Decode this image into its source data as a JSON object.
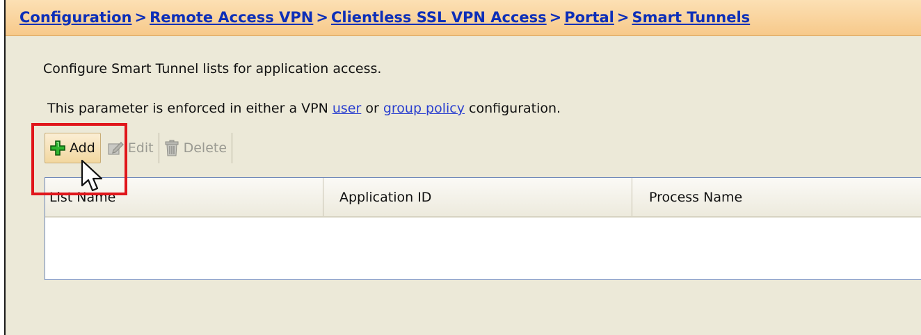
{
  "breadcrumb": {
    "items": [
      "Configuration",
      "Remote Access VPN",
      "Clientless SSL VPN Access",
      "Portal",
      "Smart Tunnels"
    ],
    "separator": ">"
  },
  "description": "Configure Smart Tunnel lists for application access.",
  "policy_note": {
    "prefix": "This parameter is enforced in either a VPN ",
    "link_user": "user",
    "middle": " or ",
    "link_group_policy": "group policy",
    "suffix": " configuration."
  },
  "toolbar": {
    "add_label": "Add",
    "edit_label": "Edit",
    "delete_label": "Delete"
  },
  "table": {
    "columns": [
      "List Name",
      "Application ID",
      "Process Name"
    ],
    "rows": []
  },
  "colors": {
    "breadcrumb_link": "#0d2fb8",
    "highlight": "#e0161b",
    "panel_bg": "#ece9d8",
    "add_icon": "#1f9a1f"
  },
  "icons": {
    "add": "plus-icon",
    "edit": "edit-icon",
    "delete": "trash-icon",
    "cursor": "mouse-pointer-icon"
  }
}
